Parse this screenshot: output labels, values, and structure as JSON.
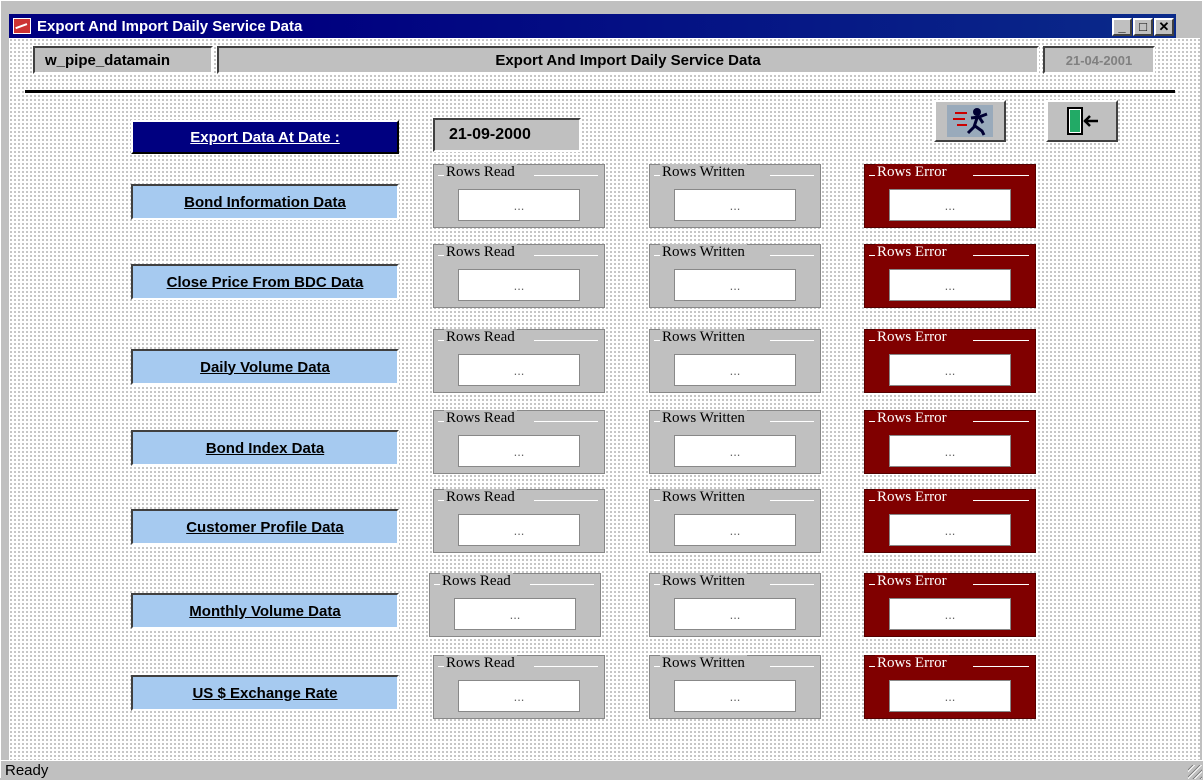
{
  "window": {
    "title": "Export And Import Daily Service Data",
    "buttons": {
      "minimize": "_",
      "maximize": "□",
      "close": "✕"
    }
  },
  "header": {
    "datawindow_name": "w_pipe_datamain",
    "title": "Export And Import Daily Service Data",
    "date": "21-04-2001"
  },
  "export": {
    "label": "Export Data At Date :",
    "date": "21-09-2000"
  },
  "toolbar": {
    "run_icon": "running-man-icon",
    "exit_icon": "exit-door-icon"
  },
  "group_titles": {
    "read": "Rows Read",
    "written": "Rows Written",
    "error": "Rows Error"
  },
  "rows": [
    {
      "label": "Bond Information Data",
      "read": "...",
      "written": "...",
      "error": "..."
    },
    {
      "label": "Close Price From BDC Data",
      "read": "...",
      "written": "...",
      "error": "..."
    },
    {
      "label": "Daily Volume Data",
      "read": "...",
      "written": "...",
      "error": "..."
    },
    {
      "label": "Bond Index Data",
      "read": "...",
      "written": "...",
      "error": "..."
    },
    {
      "label": "Customer Profile Data",
      "read": "...",
      "written": "...",
      "error": "..."
    },
    {
      "label": "Monthly Volume Data",
      "read": "...",
      "written": "...",
      "error": "..."
    },
    {
      "label": "US $ Exchange Rate",
      "read": "...",
      "written": "...",
      "error": "..."
    }
  ],
  "status": {
    "text": "Ready"
  },
  "colors": {
    "title_bar": "#000080",
    "label_bg": "#a6caf0",
    "error_group": "#800000",
    "panel": "#c0c0c0"
  }
}
